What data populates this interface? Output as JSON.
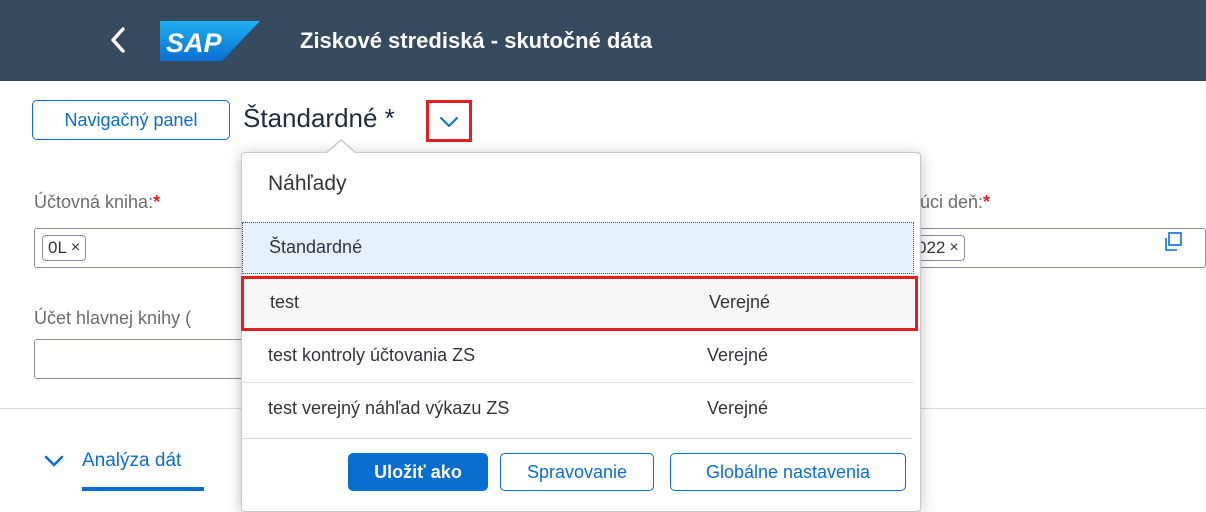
{
  "shell": {
    "title": "Ziskové strediská - skutočné dáta",
    "logo_text": "SAP",
    "colors": {
      "shell_bg": "#354a5f",
      "accent": "#0a6ed1",
      "highlight": "#e02020"
    }
  },
  "toolbar": {
    "nav_panel_label": "Navigačný panel",
    "variant_title": "Štandardné *"
  },
  "filters": {
    "ledger_label": "Účtovná kniha:",
    "ledger_token": "0L",
    "gl_account_label": "Účet hlavnej knihy (",
    "day_label": "júci deň:",
    "day_token": "022",
    "required_marker": "*",
    "token_remove": "×"
  },
  "variants_popover": {
    "title": "Náhľady",
    "items": [
      {
        "name": "Štandardné",
        "share": ""
      },
      {
        "name": "test",
        "share": "Verejné"
      },
      {
        "name": "test kontroly účtovania ZS",
        "share": "Verejné"
      },
      {
        "name": "test verejný náhľad výkazu ZS",
        "share": "Verejné"
      }
    ],
    "save_as_label": "Uložiť ako",
    "manage_label": "Spravovanie",
    "global_settings_label": "Globálne nastavenia"
  },
  "tabs": {
    "data_analysis_label": "Analýza dát"
  }
}
